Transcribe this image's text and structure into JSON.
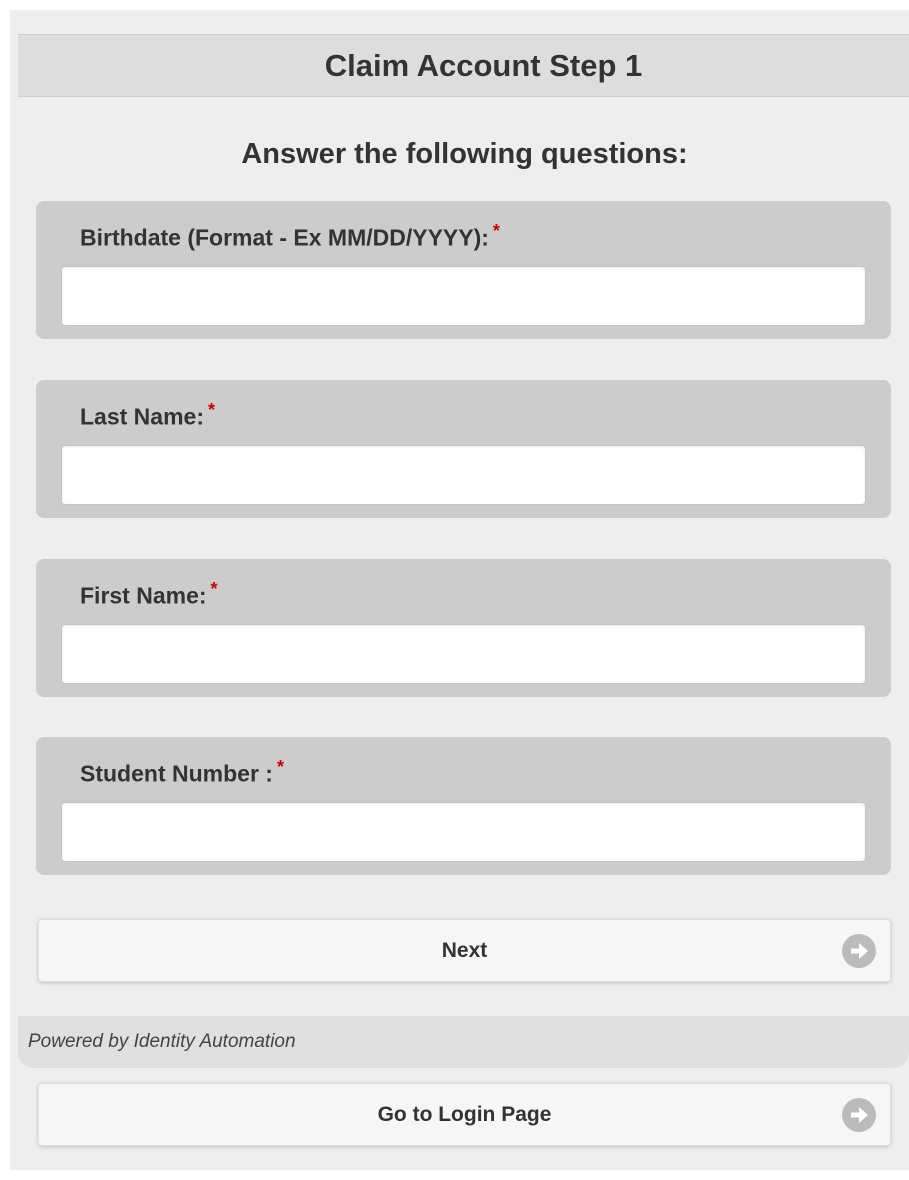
{
  "header": {
    "title": "Claim Account Step 1"
  },
  "form": {
    "heading": "Answer the following questions:",
    "required_marker": "*",
    "fields": [
      {
        "label": "Birthdate (Format - Ex MM/DD/YYYY):",
        "value": "",
        "placeholder": ""
      },
      {
        "label": "Last Name:",
        "value": "",
        "placeholder": ""
      },
      {
        "label": "First Name:",
        "value": "",
        "placeholder": ""
      },
      {
        "label": "Student Number :",
        "value": "",
        "placeholder": ""
      }
    ]
  },
  "buttons": {
    "next_label": "Next",
    "login_label": "Go to Login Page",
    "icon": "arrow-right-circle-icon"
  },
  "footer": {
    "powered_by": "Powered by Identity Automation"
  },
  "colors": {
    "page_background": "#eeeeee",
    "card_background": "#cccccc",
    "required_star": "#cc0000",
    "icon_gray": "#bbbbbb"
  }
}
